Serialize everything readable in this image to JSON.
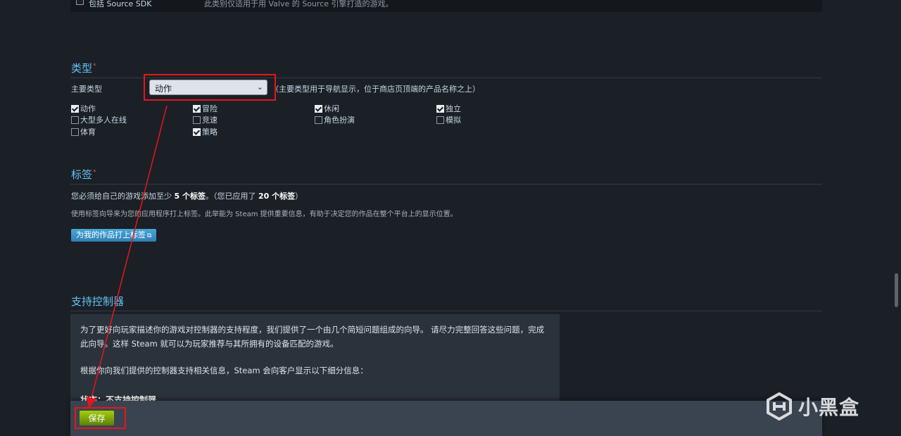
{
  "source_sdk": {
    "label": "包括 Source SDK",
    "desc": "此类别仅适用于用 Valve 的 Source 引擎打造的游戏。",
    "checked": false
  },
  "genre": {
    "title": "类型",
    "required_mark": "*",
    "primary_label": "主要类型",
    "primary_value": "动作",
    "primary_hint": "（主要类型用于导航显示，位于商店页顶端的产品名称之上）",
    "items": [
      {
        "label": "动作",
        "checked": true
      },
      {
        "label": "冒险",
        "checked": true
      },
      {
        "label": "休闲",
        "checked": true
      },
      {
        "label": "独立",
        "checked": true
      },
      {
        "label": "大型多人在线",
        "checked": false
      },
      {
        "label": "竞速",
        "checked": false
      },
      {
        "label": "角色扮演",
        "checked": false
      },
      {
        "label": "模拟",
        "checked": false
      },
      {
        "label": "体育",
        "checked": false
      },
      {
        "label": "策略",
        "checked": true
      }
    ]
  },
  "tags": {
    "title": "标签",
    "required_mark": "*",
    "line1_prefix": "您必须给自己的游戏添加至少 ",
    "line1_min": "5 个标签",
    "line1_mid": "。（您已应用了 ",
    "line1_count": "20 个标签",
    "line1_suffix": "）",
    "line2": "使用标签向导来为您的应用程序打上标签。此举能为 Steam 提供重要信息，有助于决定您的作品在整个平台上的显示位置。",
    "button_label": "为我的作品打上标签"
  },
  "controller": {
    "title": "支持控制器",
    "para1": "为了更好向玩家描述你的游戏对控制器的支持程度，我们提供了一个由几个简短问题组成的向导。 请尽力完整回答这些问题，完成此向导。这样 Steam 就可以为玩家推荐与其所拥有的设备匹配的游戏。",
    "para2": "根据你向我们提供的控制器支持相关信息，Steam 会向客户显示以下细分信息：",
    "status": "状态：不支持控制器"
  },
  "footer": {
    "save_label": "保存"
  },
  "watermark": {
    "text": "小黑盒"
  },
  "colors": {
    "accent_blue": "#66c0f4",
    "save_green": "#a4d007",
    "annotation_red": "#e8141b"
  }
}
